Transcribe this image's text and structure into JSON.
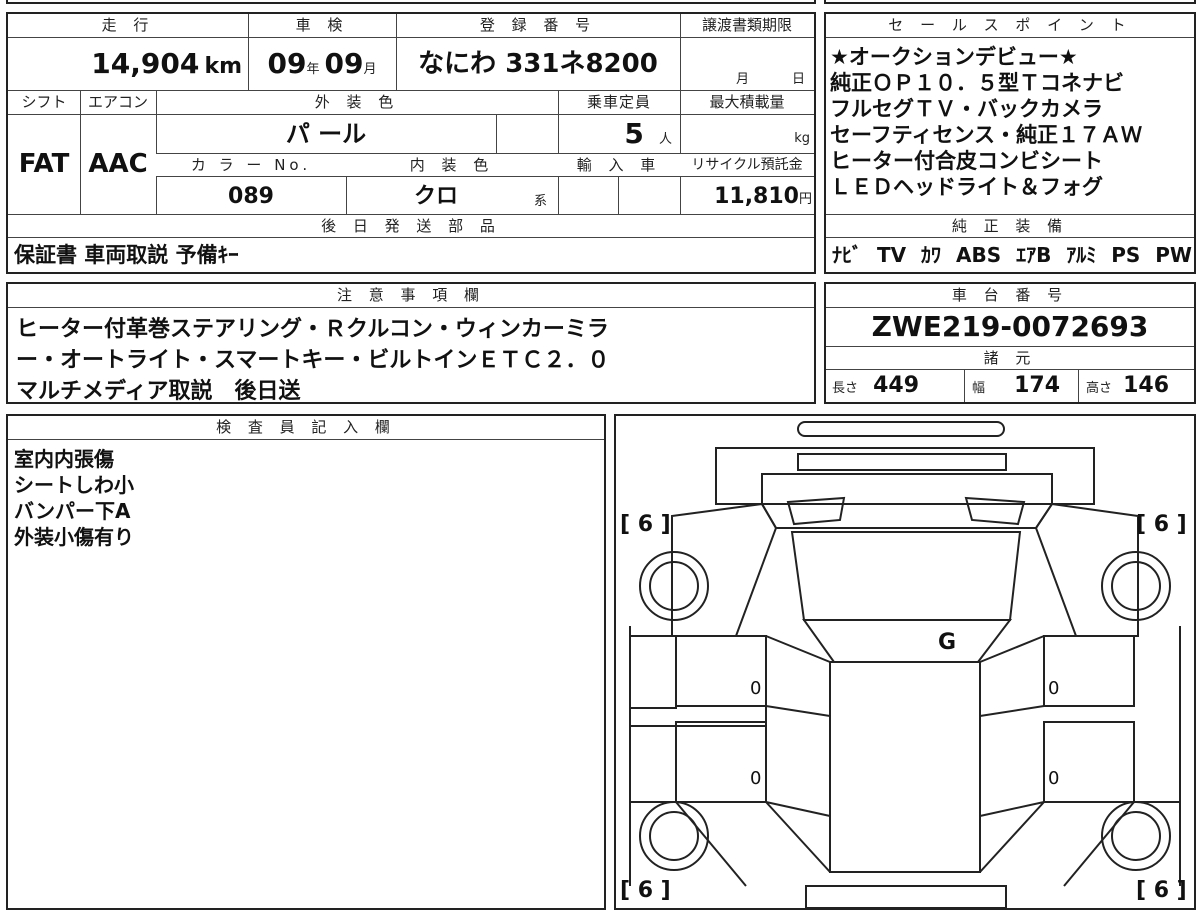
{
  "main_table": {
    "mileage_header": "走 行",
    "inspection_header": "車 検",
    "registration_header": "登 録 番 号",
    "transfer_header": "譲渡書類期限",
    "mileage_value": "14,904",
    "mileage_unit": "km",
    "inspection_year": "09",
    "inspection_year_unit": "年",
    "inspection_month": "09",
    "inspection_month_unit": "月",
    "registration_value": "なにわ 331ネ8200",
    "transfer_month_unit": "月",
    "transfer_day_unit": "日",
    "shift_header": "シフト",
    "aircon_header": "エアコン",
    "exterior_color_header": "外 装 色",
    "capacity_header": "乗車定員",
    "max_load_header": "最大積載量",
    "shift_value": "FAT",
    "aircon_value": "AAC",
    "exterior_color_value": "パ ール",
    "capacity_value": "5",
    "capacity_unit": "人",
    "max_load_unit": "kg",
    "color_no_header": "カ ラ ー No.",
    "interior_color_header": "内 装 色",
    "import_header": "輸 入 車",
    "recycle_header": "リサイクル預託金",
    "color_no_value": "089",
    "interior_color_value": "クロ",
    "interior_color_unit": "系",
    "recycle_value": "11,810",
    "recycle_unit": "円",
    "later_parts_header": "後 日 発 送 部 品",
    "later_parts_value": "保証書 車両取説 予備ｷｰ"
  },
  "sales_points": {
    "header": "セ ー ル ス ポ イ ン ト",
    "lines": [
      "★オークションデビュー★",
      "純正ＯＰ１０．５型Ｔコネナビ",
      "フルセグＴＶ・バックカメラ",
      "セーフティセンス・純正１７ＡＷ",
      "ヒーター付合皮コンビシート",
      "ＬＥＤヘッドライト＆フォグ"
    ],
    "equipment_header": "純 正 装 備",
    "equipment": [
      "ﾅﾋﾞ",
      "TV",
      "ｶﾜ",
      "ABS",
      "ｴｱB",
      "ｱﾙﾐ",
      "PS",
      "PW"
    ]
  },
  "notes": {
    "header": "注 意 事 項 欄",
    "lines": [
      "ヒーター付革巻ステアリング・Ｒクルコン・ウィンカーミラ",
      "ー・オートライト・スマートキー・ビルトインＥＴＣ２．０",
      "マルチメディア取説　後日送"
    ]
  },
  "chassis": {
    "header": "車 台 番 号",
    "value": "ZWE219-0072693",
    "spec_header": "諸 元",
    "length_label": "長さ",
    "length_value": "449",
    "width_label": "幅",
    "width_value": "174",
    "height_label": "高さ",
    "height_value": "146"
  },
  "inspector": {
    "header": "検 査 員 記 入 欄",
    "lines": [
      "室内内張傷",
      "シートしわ小",
      "バンパー下A",
      "外装小傷有り"
    ]
  },
  "diagram": {
    "tire_fl": "[ 6 ]",
    "tire_fr": "[ 6 ]",
    "tire_rl": "[ 6 ]",
    "tire_rr": "[ 6 ]",
    "roof_mark": "G",
    "door_fl": "0",
    "door_fr": "0",
    "door_rl": "0",
    "door_rr": "0"
  }
}
